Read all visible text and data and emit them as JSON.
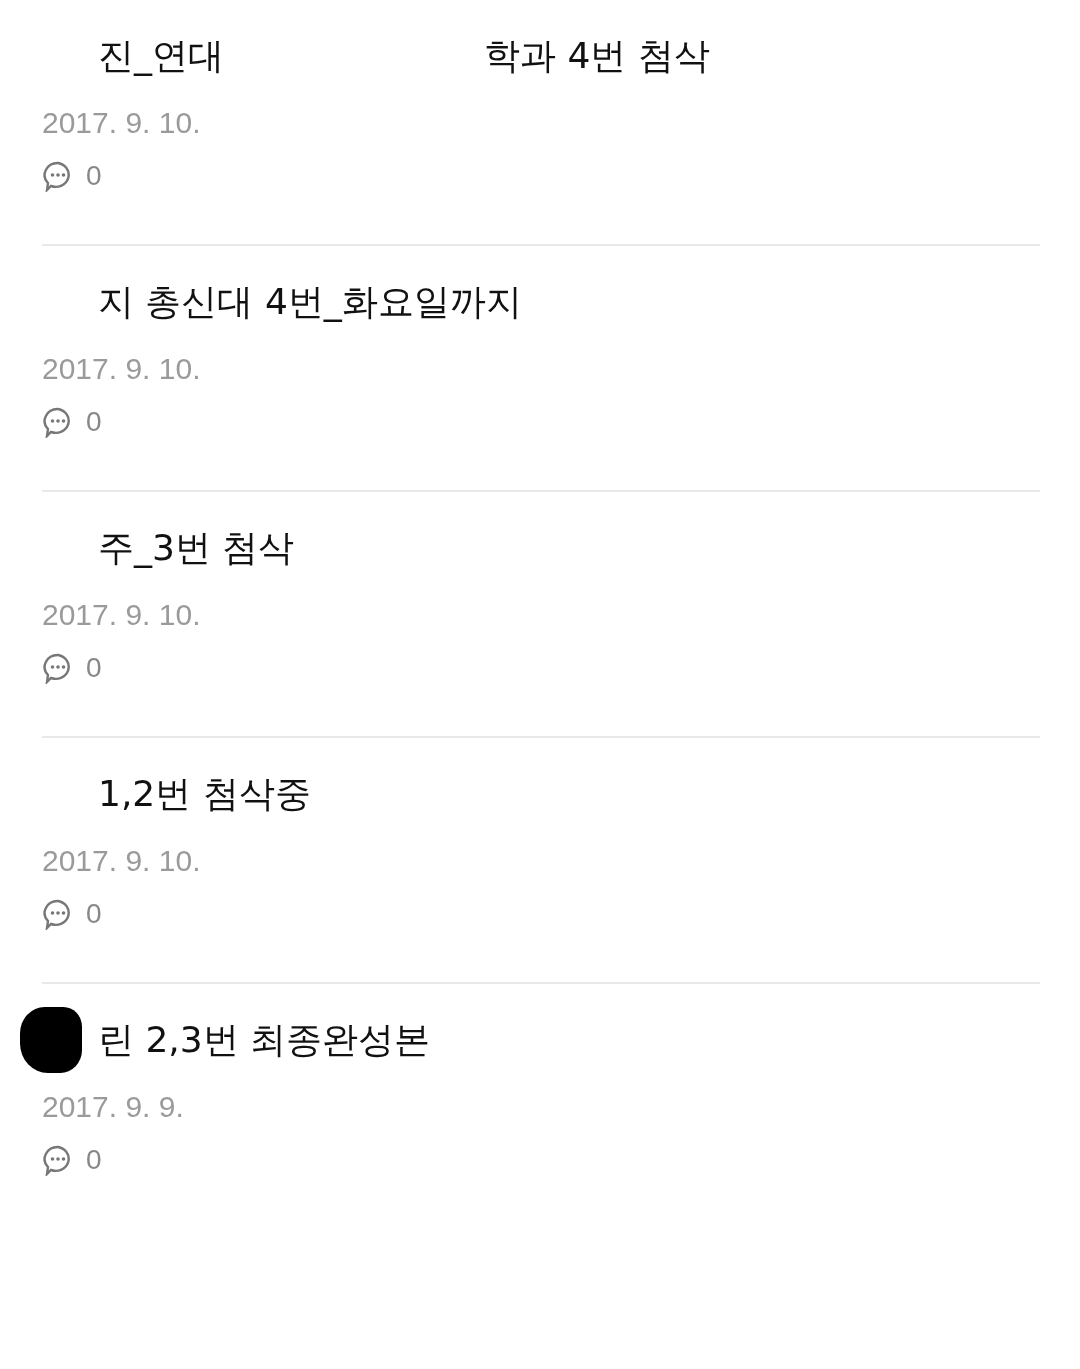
{
  "posts": [
    {
      "title": [
        "진_연대",
        "학과 4번 첨삭"
      ],
      "date": "2017. 9. 10.",
      "comments": "0",
      "redacted": false
    },
    {
      "title": [
        "지 총신대 4번_화요일까지"
      ],
      "date": "2017. 9. 10.",
      "comments": "0",
      "redacted": false
    },
    {
      "title": [
        "주_3번 첨삭"
      ],
      "date": "2017. 9. 10.",
      "comments": "0",
      "redacted": false
    },
    {
      "title": [
        "1,2번 첨삭중"
      ],
      "date": "2017. 9. 10.",
      "comments": "0",
      "redacted": false
    },
    {
      "title": [
        "린 2,3번 최종완성본"
      ],
      "date": "2017. 9. 9.",
      "comments": "0",
      "redacted": true
    }
  ]
}
